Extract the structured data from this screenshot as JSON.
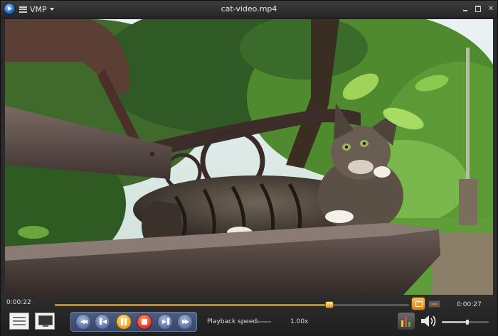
{
  "window": {
    "title": "cat-video.mp4",
    "menu_label": "VMP",
    "icons": {
      "app": "app-logo-icon",
      "menu": "hamburger-menu-icon",
      "minimize": "minimize-icon",
      "maximize": "maximize-icon",
      "close": "close-icon"
    },
    "close_glyph": "✕"
  },
  "video": {
    "content": "video-frame"
  },
  "playback": {
    "current_time": "0:00:22",
    "total_time": "0:00:27",
    "progress": 0.776,
    "speed_label": "Playback speed:",
    "speed_value": "1.00x",
    "volume": 0.55
  },
  "controls": {
    "icons": [
      "playlist-icon",
      "screen-mode-icon",
      "rewind-icon",
      "previous-frame-icon",
      "pause-icon",
      "stop-icon",
      "next-frame-icon",
      "fast-forward-icon",
      "snapshot-icon",
      "mini-mode-icon",
      "equalizer-icon",
      "speaker-icon"
    ],
    "glyphs": {
      "rewind": "◀◀",
      "prev": "▌◀",
      "next": "▶▐",
      "forward": "▶▶"
    }
  },
  "colors": {
    "seek_fill": "#b08c4a",
    "play_button": "#e7a018",
    "stop_button": "#e0321b",
    "transport_group": "#4d5f86"
  }
}
